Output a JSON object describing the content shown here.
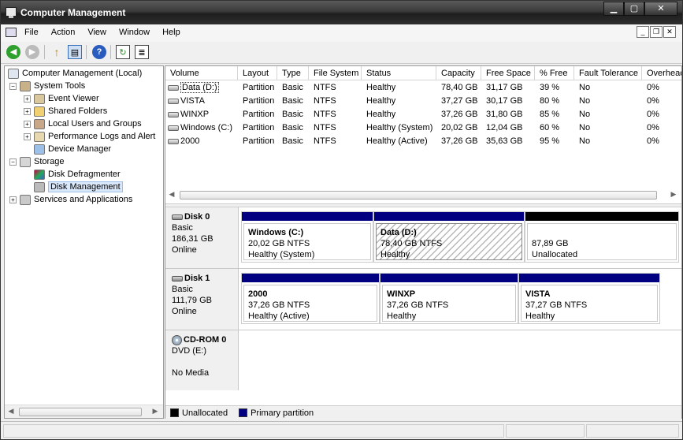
{
  "window": {
    "title": "Computer Management"
  },
  "caption_buttons": {
    "minimize": "▁",
    "maximize": "▢",
    "close": "✕"
  },
  "menu": {
    "items": [
      "File",
      "Action",
      "View",
      "Window",
      "Help"
    ]
  },
  "mdi_buttons": {
    "minimize": "_",
    "restore": "❐",
    "close": "✕"
  },
  "toolbar": {
    "icons": [
      "back-arrow-icon",
      "forward-arrow-icon",
      "up-folder-icon",
      "show-hide-tree-icon",
      "help-icon",
      "refresh-icon",
      "properties-icon"
    ],
    "glyphs": {
      "back": "◀",
      "forward": "▶",
      "up": "↑",
      "tree": "▤",
      "help": "?",
      "refresh": "↻",
      "props": "≣"
    }
  },
  "tree": {
    "root": "Computer Management (Local)",
    "system_tools": "System Tools",
    "event_viewer": "Event Viewer",
    "shared_folders": "Shared Folders",
    "local_users": "Local Users and Groups",
    "perf_logs": "Performance Logs and Alert",
    "device_manager": "Device Manager",
    "storage": "Storage",
    "disk_defrag": "Disk Defragmenter",
    "disk_mgmt": "Disk Management",
    "services": "Services and Applications",
    "expand_minus": "−",
    "expand_plus": "+"
  },
  "volume_list": {
    "columns": [
      "Volume",
      "Layout",
      "Type",
      "File System",
      "Status",
      "Capacity",
      "Free Space",
      "% Free",
      "Fault Tolerance",
      "Overhead"
    ],
    "rows": [
      [
        "Data (D:)",
        "Partition",
        "Basic",
        "NTFS",
        "Healthy",
        "78,40 GB",
        "31,17 GB",
        "39 %",
        "No",
        "0%"
      ],
      [
        "VISTA",
        "Partition",
        "Basic",
        "NTFS",
        "Healthy",
        "37,27 GB",
        "30,17 GB",
        "80 %",
        "No",
        "0%"
      ],
      [
        "WINXP",
        "Partition",
        "Basic",
        "NTFS",
        "Healthy",
        "37,26 GB",
        "31,80 GB",
        "85 %",
        "No",
        "0%"
      ],
      [
        "Windows (C:)",
        "Partition",
        "Basic",
        "NTFS",
        "Healthy (System)",
        "20,02 GB",
        "12,04 GB",
        "60 %",
        "No",
        "0%"
      ],
      [
        "2000",
        "Partition",
        "Basic",
        "NTFS",
        "Healthy (Active)",
        "37,26 GB",
        "35,63 GB",
        "95 %",
        "No",
        "0%"
      ]
    ]
  },
  "scroll": {
    "left": "◀",
    "right": "▶"
  },
  "disks": {
    "disk0": {
      "name": "Disk 0",
      "type": "Basic",
      "size": "186,31 GB",
      "state": "Online",
      "partitions": [
        {
          "name": "Windows  (C:)",
          "size": "20,02 GB NTFS",
          "status": "Healthy (System)"
        },
        {
          "name": "Data  (D:)",
          "size": "78,40 GB NTFS",
          "status": "Healthy"
        },
        {
          "name": "",
          "size": "87,89 GB",
          "status": "Unallocated"
        }
      ]
    },
    "disk1": {
      "name": "Disk 1",
      "type": "Basic",
      "size": "111,79 GB",
      "state": "Online",
      "partitions": [
        {
          "name": "2000",
          "size": "37,26 GB NTFS",
          "status": "Healthy (Active)"
        },
        {
          "name": "WINXP",
          "size": "37,26 GB NTFS",
          "status": "Healthy"
        },
        {
          "name": "VISTA",
          "size": "37,27 GB NTFS",
          "status": "Healthy"
        }
      ]
    },
    "cdrom0": {
      "name": "CD-ROM 0",
      "type": "DVD (E:)",
      "media": "No Media"
    }
  },
  "legend": {
    "unallocated": "Unallocated",
    "primary": "Primary partition",
    "colors": {
      "unallocated": "#000000",
      "primary": "#000080"
    }
  }
}
